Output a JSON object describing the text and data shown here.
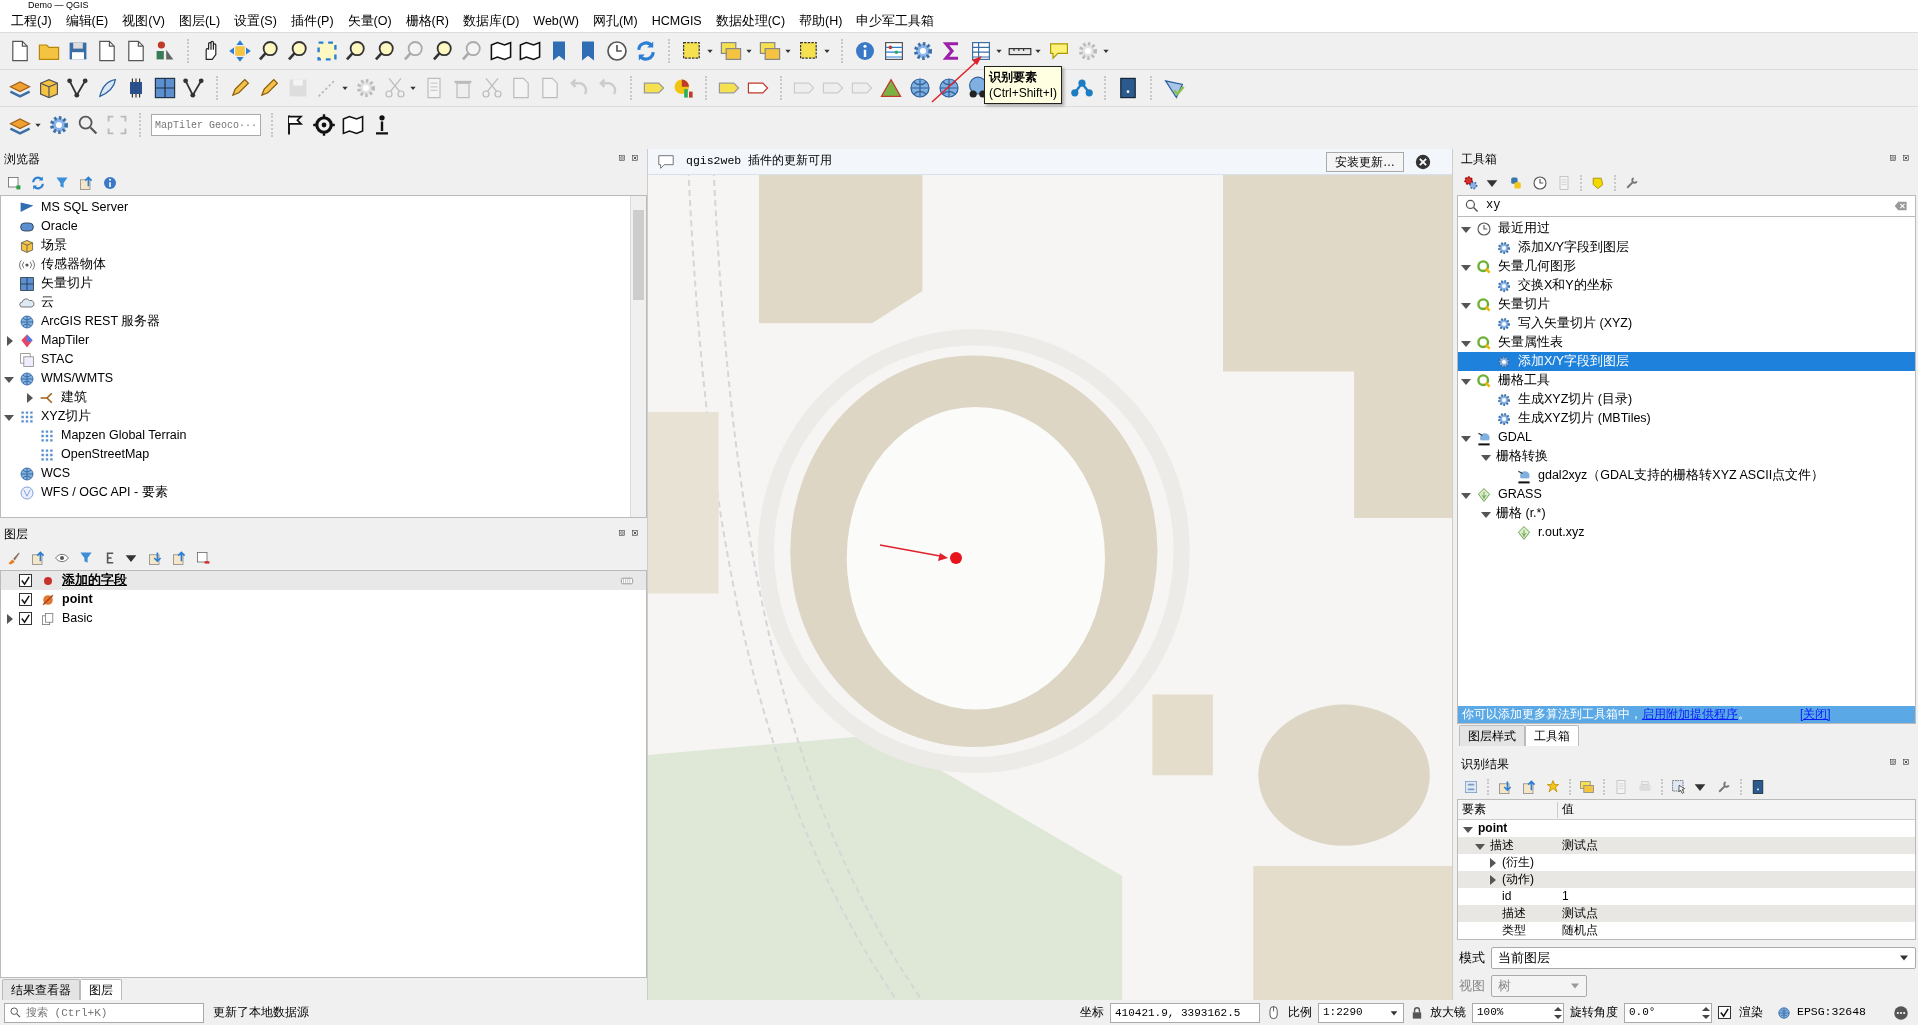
{
  "window": {
    "title": "Demo — QGIS"
  },
  "menu": [
    "工程(J)",
    "编辑(E)",
    "视图(V)",
    "图层(L)",
    "设置(S)",
    "插件(P)",
    "矢量(O)",
    "栅格(R)",
    "数据库(D)",
    "Web(W)",
    "网孔(M)",
    "HCMGIS",
    "数据处理(C)",
    "帮助(H)",
    "申少军工具箱"
  ],
  "tooltip": {
    "title": "识别要素",
    "shortcut": "(Ctrl+Shift+I)"
  },
  "geocoder": {
    "placeholder": "MapTiler Geoco···"
  },
  "browser": {
    "title": "浏览器",
    "items": [
      {
        "label": "MS SQL Server"
      },
      {
        "label": "Oracle"
      },
      {
        "label": "场景"
      },
      {
        "label": "传感器物体"
      },
      {
        "label": "矢量切片"
      },
      {
        "label": "云"
      },
      {
        "label": "ArcGIS REST 服务器"
      },
      {
        "label": "MapTiler",
        "expanded": false
      },
      {
        "label": "STAC"
      },
      {
        "label": "WMS/WMTS",
        "expanded": true,
        "children": [
          {
            "label": "建筑",
            "expanded": false
          }
        ]
      },
      {
        "label": "XYZ切片",
        "expanded": true,
        "children": [
          {
            "label": "Mapzen Global Terrain"
          },
          {
            "label": "OpenStreetMap"
          }
        ]
      },
      {
        "label": "WCS"
      },
      {
        "label": "WFS / OGC API - 要素"
      }
    ]
  },
  "layers": {
    "title": "图层",
    "items": [
      {
        "label": "添加的字段",
        "checked": true,
        "selected": true,
        "bold": true
      },
      {
        "label": "point",
        "checked": true,
        "selected": false,
        "bold": true
      },
      {
        "label": "Basic",
        "checked": true,
        "selected": false,
        "bold": false,
        "expanded": false
      }
    ]
  },
  "bottom_tabs": [
    {
      "label": "结果查看器",
      "selected": false
    },
    {
      "label": "图层",
      "selected": true
    }
  ],
  "message_bar": {
    "text": "qgis2web 插件的更新可用",
    "button": "安装更新…"
  },
  "toolbox": {
    "title": "工具箱",
    "search": "xy",
    "tree": [
      {
        "label": "最近用过",
        "expanded": true,
        "selected": false,
        "children": [
          {
            "label": "添加X/Y字段到图层",
            "selected": false
          }
        ]
      },
      {
        "label": "矢量几何图形",
        "expanded": true,
        "selected": false,
        "children": [
          {
            "label": "交换X和Y的坐标",
            "selected": false
          }
        ]
      },
      {
        "label": "矢量切片",
        "expanded": true,
        "selected": false,
        "children": [
          {
            "label": "写入矢量切片 (XYZ)",
            "selected": false
          }
        ]
      },
      {
        "label": "矢量属性表",
        "expanded": true,
        "selected": false,
        "children": [
          {
            "label": "添加X/Y字段到图层",
            "selected": true
          }
        ]
      },
      {
        "label": "栅格工具",
        "expanded": true,
        "selected": false,
        "children": [
          {
            "label": "生成XYZ切片 (目录)",
            "selected": false
          },
          {
            "label": "生成XYZ切片 (MBTiles)",
            "selected": false
          }
        ]
      },
      {
        "label": "GDAL",
        "expanded": true,
        "selected": false,
        "children": [
          {
            "label": "栅格转换",
            "expanded": true,
            "selected": false,
            "children": [
              {
                "label": "gdal2xyz（GDAL支持的栅格转XYZ ASCII点文件）",
                "selected": false
              }
            ]
          }
        ]
      },
      {
        "label": "GRASS",
        "expanded": true,
        "selected": false,
        "children": [
          {
            "label": "栅格 (r.*)",
            "expanded": true,
            "selected": false,
            "children": [
              {
                "label": "r.out.xyz",
                "selected": false
              }
            ]
          }
        ]
      }
    ],
    "info": {
      "text": "你可以添加更多算法到工具箱中，",
      "link": "启用附加提供程序",
      "tail": "。",
      "close": "[关闭]"
    }
  },
  "dock_tabs": [
    {
      "label": "图层样式",
      "selected": false
    },
    {
      "label": "工具箱",
      "selected": true
    }
  ],
  "identify": {
    "title": "识别结果",
    "columns": [
      "要素",
      "值"
    ],
    "rows": [
      {
        "feature": "point",
        "expanded": true,
        "children": [
          {
            "feature": "描述",
            "value": "测试点",
            "expanded": true,
            "children": [
              {
                "feature": "(衍生)",
                "expanded": false
              },
              {
                "feature": "(动作)",
                "expanded": false
              },
              {
                "feature": "id",
                "value": "1"
              },
              {
                "feature": "描述",
                "value": "测试点"
              },
              {
                "feature": "类型",
                "value": "随机点"
              }
            ]
          }
        ]
      }
    ],
    "mode": {
      "label": "模式",
      "value": "当前图层"
    },
    "view": {
      "label": "视图",
      "value": "树",
      "disabled": true
    }
  },
  "status_bar": {
    "search_placeholder": "搜索 (Ctrl+K)",
    "message": "更新了本地数据源",
    "coordinate_label": "坐标",
    "coordinate": "410421.9, 3393162.5",
    "scale_label": "比例",
    "scale": "1:2290",
    "magnifier_label": "放大镜",
    "magnifier": "100%",
    "rotation_label": "旋转角度",
    "rotation": "0.0°",
    "render": {
      "label": "渲染",
      "checked": true
    },
    "crs": "EPSG:32648"
  }
}
